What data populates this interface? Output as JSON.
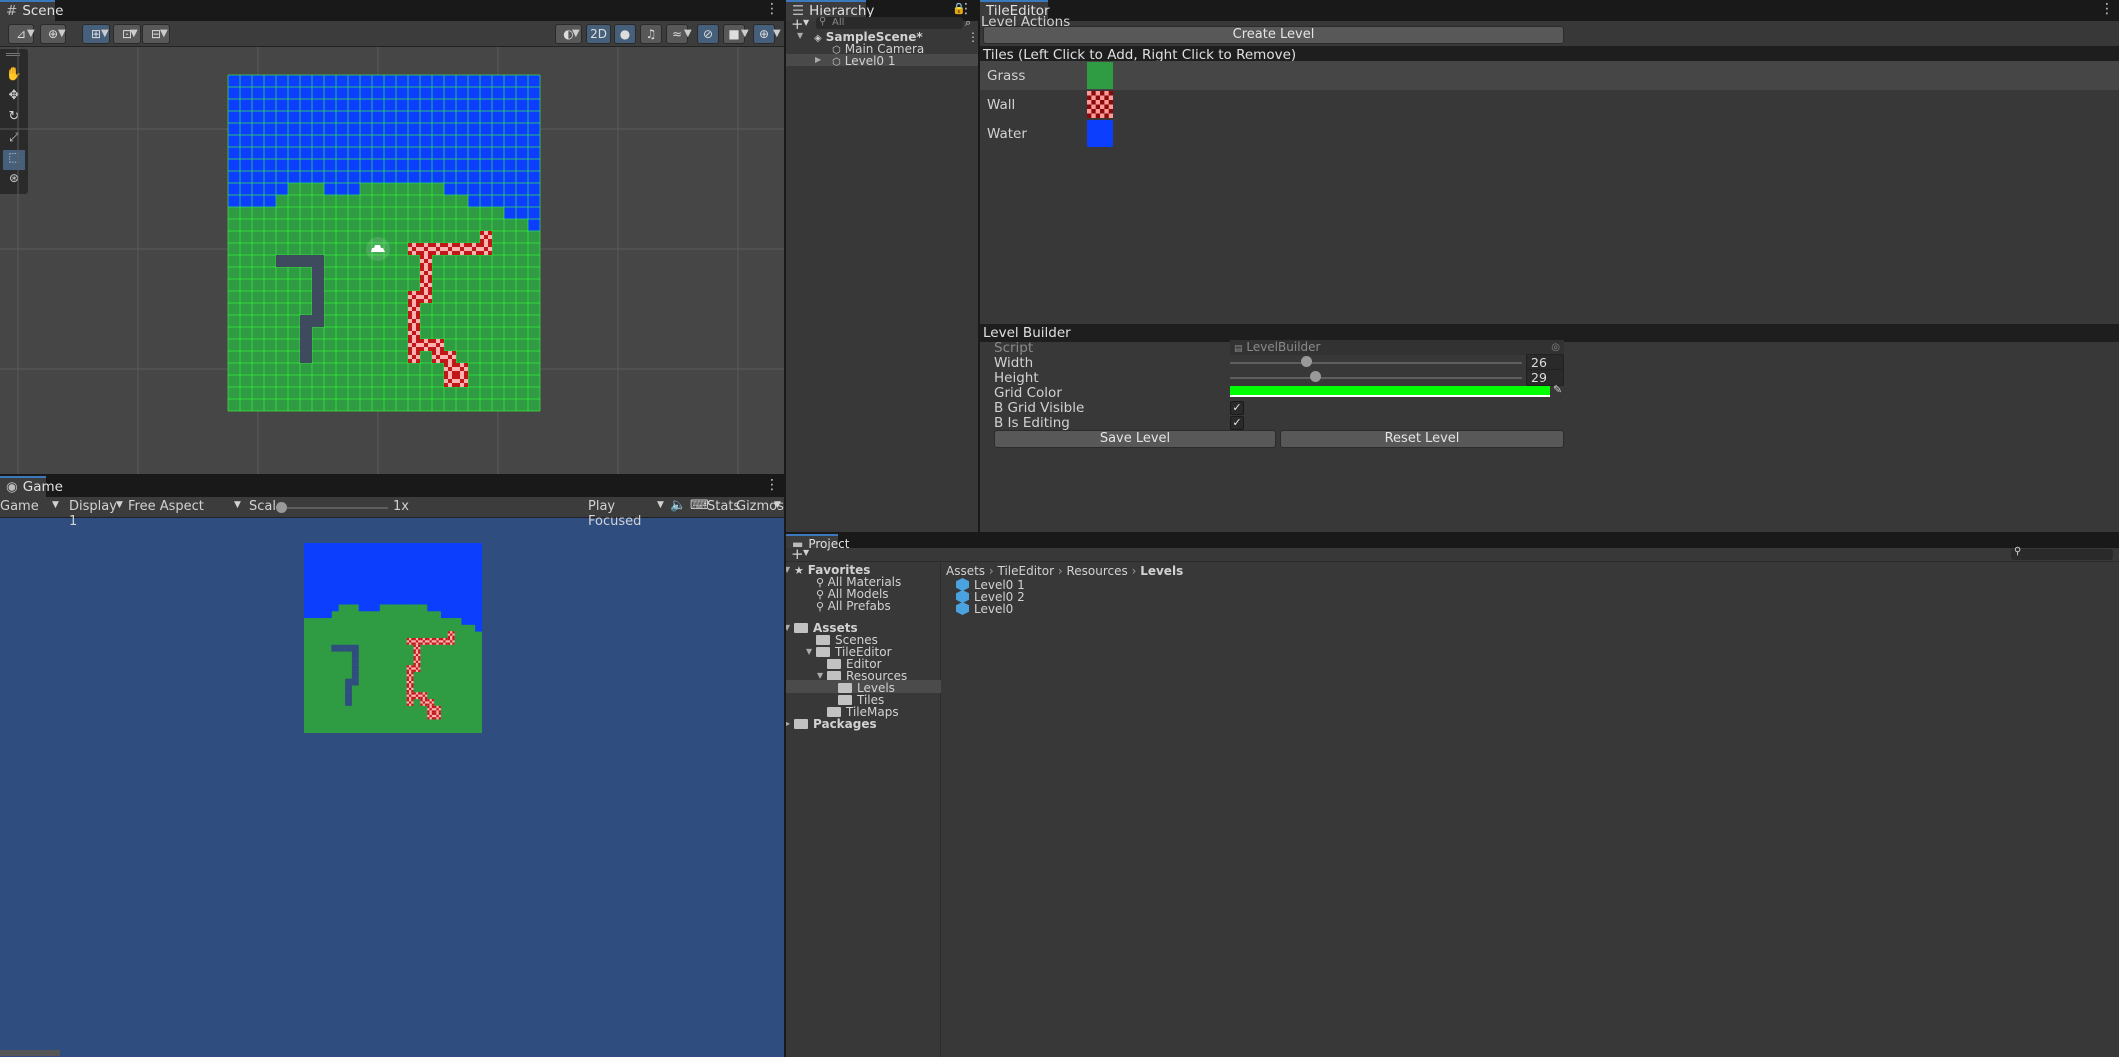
{
  "scene": {
    "tab": "Scene",
    "toolbar_right": {
      "mode2d": "2D"
    },
    "tools": [
      "hand-tool-icon",
      "move-tool-icon",
      "rotate-tool-icon",
      "scale-tool-icon",
      "rect-tool-icon",
      "transform-tool-icon"
    ],
    "grid": {
      "cols": 26,
      "rows": 28,
      "water_cols_row10": [
        0,
        1,
        2,
        3,
        4,
        5,
        11,
        12,
        13,
        19,
        20,
        21,
        22,
        23,
        24,
        25
      ],
      "colors": {
        "grass": "#2f9b43",
        "water": "#0c3efe",
        "gridline": "#3aff3a"
      }
    }
  },
  "game": {
    "tab": "Game",
    "toolbar": {
      "game_dd": "Game",
      "display_dd": "Display 1",
      "aspect_dd": "Free Aspect",
      "scale_label": "Scale",
      "scale_value": "1x",
      "play_focused": "Play Focused",
      "stats": "Stats",
      "gizmos": "Gizmos"
    },
    "bg": "#2f4e7f"
  },
  "hierarchy": {
    "tab": "Hierarchy",
    "search_placeholder": "All",
    "items": [
      {
        "label": "SampleScene*",
        "level": 0,
        "expanded": true,
        "icon": "unity-scene-icon"
      },
      {
        "label": "Main Camera",
        "level": 1,
        "icon": "gameobject-icon"
      },
      {
        "label": "Level0 1",
        "level": 1,
        "icon": "gameobject-icon",
        "collapsed": true
      }
    ]
  },
  "tileeditor": {
    "tab": "TileEditor",
    "level_actions": "Level Actions",
    "create_level": "Create Level",
    "tiles_header": "Tiles (Left Click to Add, Right Click to Remove)",
    "tiles": [
      {
        "name": "Grass",
        "color": "#2f9b43",
        "pattern": "solid"
      },
      {
        "name": "Wall",
        "color": "#d32a2a",
        "pattern": "checker"
      },
      {
        "name": "Water",
        "color": "#0c3efe",
        "pattern": "solid"
      }
    ],
    "builder_header": "Level Builder",
    "script_label": "Script",
    "script_value": "LevelBuilder",
    "width_label": "Width",
    "width_value": "26",
    "width_fraction": 0.26,
    "height_label": "Height",
    "height_value": "29",
    "height_fraction": 0.29,
    "grid_color_label": "Grid Color",
    "grid_color": "#00ff00",
    "grid_visible_label": "B Grid Visible",
    "grid_visible": true,
    "is_editing_label": "B Is Editing",
    "is_editing": true,
    "save_level": "Save Level",
    "reset_level": "Reset Level"
  },
  "project": {
    "tab": "Project",
    "favorites_label": "Favorites",
    "favorites": [
      "All Materials",
      "All Models",
      "All Prefabs"
    ],
    "assets_label": "Assets",
    "tree": [
      {
        "label": "Scenes",
        "level": 1
      },
      {
        "label": "TileEditor",
        "level": 1,
        "expanded": true
      },
      {
        "label": "Editor",
        "level": 2
      },
      {
        "label": "Resources",
        "level": 2,
        "expanded": true
      },
      {
        "label": "Levels",
        "level": 3,
        "selected": true
      },
      {
        "label": "Tiles",
        "level": 3
      },
      {
        "label": "TileMaps",
        "level": 2
      }
    ],
    "packages_label": "Packages",
    "breadcrumb": [
      "Assets",
      "TileEditor",
      "Resources",
      "Levels"
    ],
    "files": [
      "Level0 1",
      "Level0 2",
      "Level0"
    ]
  }
}
